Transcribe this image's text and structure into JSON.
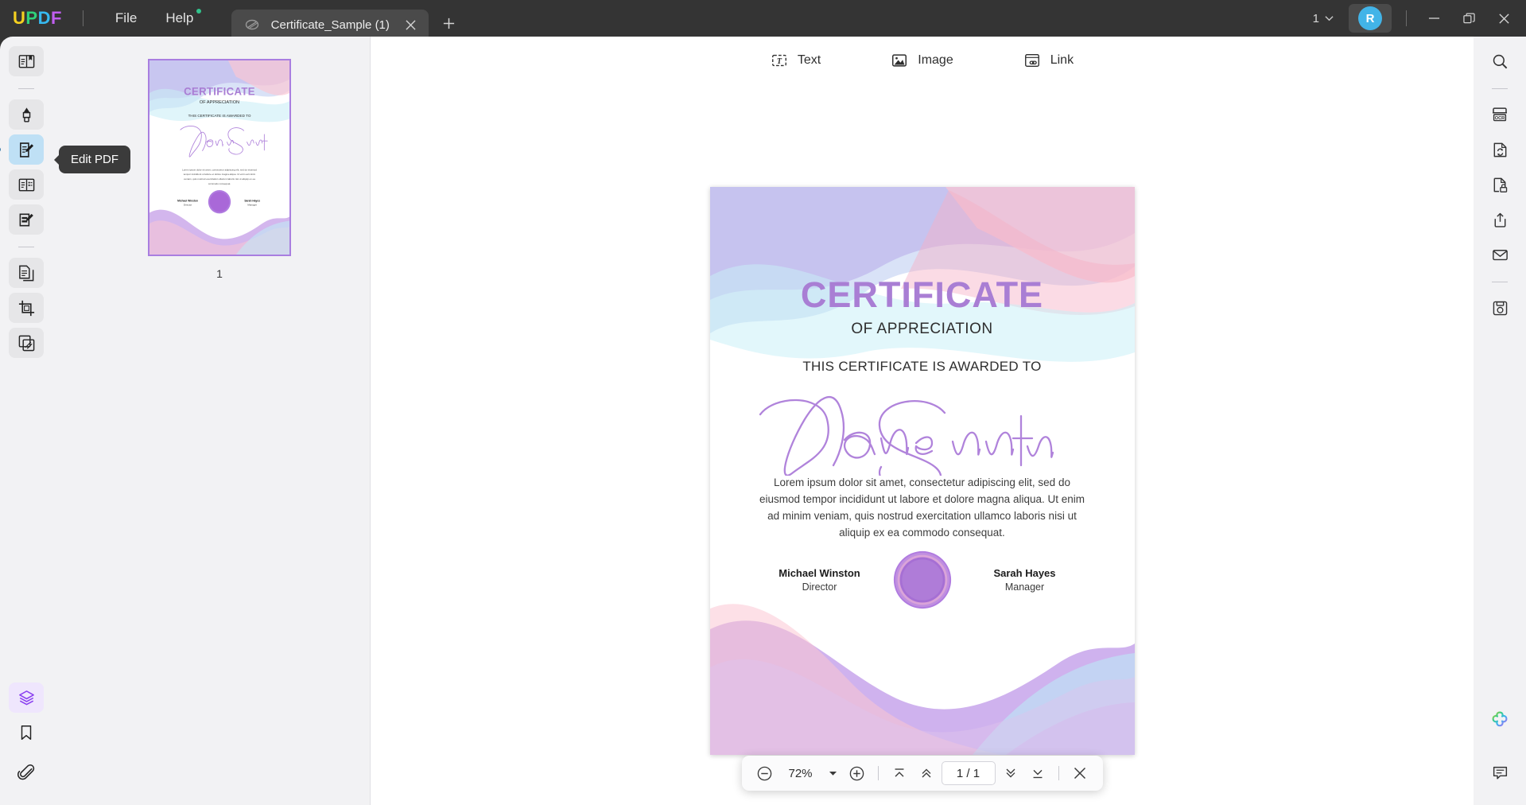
{
  "app": {
    "logo_letters": [
      {
        "ch": "U",
        "color": "#f5d020"
      },
      {
        "ch": "P",
        "color": "#2fd07a"
      },
      {
        "ch": "D",
        "color": "#36b9f0"
      },
      {
        "ch": "F",
        "color": "#c05ef0"
      }
    ],
    "menus": [
      {
        "label": "File",
        "has_dot": false
      },
      {
        "label": "Help",
        "has_dot": true
      }
    ],
    "tab": {
      "title": "Certificate_Sample (1)",
      "close_label": "×",
      "newtab_label": "+"
    },
    "window": {
      "account_count": "1",
      "avatar_initial": "R",
      "minimize_label": "minimize",
      "maximize_label": "maximize",
      "close_label": "close"
    },
    "accent_color": "#a97ed4",
    "active_tool_color": "#bfe0f5"
  },
  "left_rail": {
    "items": [
      {
        "name": "reader-tool",
        "icon": "book-reader-icon",
        "active": false,
        "style": "plain"
      },
      {
        "name": "comment-tool",
        "icon": "highlighter-pen-icon",
        "active": false,
        "style": "plain"
      },
      {
        "name": "edit-pdf-tool",
        "icon": "edit-document-icon",
        "active": true,
        "style": "active"
      },
      {
        "name": "organize-pages-tool",
        "icon": "page-layout-icon",
        "active": false,
        "style": "plain"
      },
      {
        "name": "form-tool",
        "icon": "form-edit-icon",
        "active": false,
        "style": "plain"
      },
      {
        "name": "convert-tool",
        "icon": "copy-pages-icon",
        "active": false,
        "style": "plain"
      },
      {
        "name": "crop-tool",
        "icon": "crop-icon",
        "active": false,
        "style": "plain"
      },
      {
        "name": "protect-tool",
        "icon": "watermark-icon",
        "active": false,
        "style": "plain"
      }
    ],
    "bottom_items": [
      {
        "name": "layers-panel",
        "icon": "layers-icon",
        "style": "purple"
      },
      {
        "name": "bookmarks-panel",
        "icon": "bookmark-icon",
        "style": "plain"
      },
      {
        "name": "attachments-panel",
        "icon": "paperclip-icon",
        "style": "plain"
      }
    ]
  },
  "tooltip": {
    "text": "Edit PDF"
  },
  "thumbnails": {
    "pages": [
      {
        "number": "1",
        "selected": true
      }
    ]
  },
  "edit_toolbar": {
    "tools": [
      {
        "label": "Text",
        "icon": "text-box-icon"
      },
      {
        "label": "Image",
        "icon": "image-icon"
      },
      {
        "label": "Link",
        "icon": "link-icon"
      }
    ]
  },
  "certificate": {
    "title": "CERTIFICATE",
    "subtitle": "OF APPRECIATION",
    "awarded_line": "THIS CERTIFICATE IS AWARDED TO",
    "recipient": "Jane Smith",
    "body": "Lorem ipsum dolor sit amet, consectetur adipiscing elit, sed do eiusmod tempor incididunt ut labore et dolore magna aliqua. Ut enim ad minim veniam, quis nostrud exercitation ullamco laboris nisi ut aliquip ex ea commodo consequat.",
    "signatories": [
      {
        "name": "Michael Winston",
        "role": "Director"
      },
      {
        "name": "Sarah Hayes",
        "role": "Manager"
      }
    ]
  },
  "bottom_toolbar": {
    "zoom_out_icon": "minus-circle-icon",
    "zoom_level": "72%",
    "zoom_dropdown_icon": "caret-down-icon",
    "zoom_in_icon": "plus-circle-icon",
    "first_page_icon": "first-page-icon",
    "prev_page_icon": "prev-page-icon",
    "page_indicator": "1 / 1",
    "next_page_icon": "next-page-icon",
    "last_page_icon": "last-page-icon",
    "close_icon": "close-icon"
  },
  "right_rail": {
    "items": [
      {
        "name": "search-tool",
        "icon": "search-icon"
      },
      {
        "name": "ocr-tool",
        "icon": "ocr-icon"
      },
      {
        "name": "convert-file-tool",
        "icon": "convert-icon"
      },
      {
        "name": "protect-file-tool",
        "icon": "lock-document-icon"
      },
      {
        "name": "share-tool",
        "icon": "share-icon"
      },
      {
        "name": "email-tool",
        "icon": "envelope-icon"
      },
      {
        "name": "save-tool",
        "icon": "floppy-save-icon"
      }
    ],
    "bottom_items": [
      {
        "name": "ai-assistant",
        "icon": "ai-clover-icon"
      },
      {
        "name": "comments-panel",
        "icon": "comment-bubble-icon"
      }
    ]
  }
}
